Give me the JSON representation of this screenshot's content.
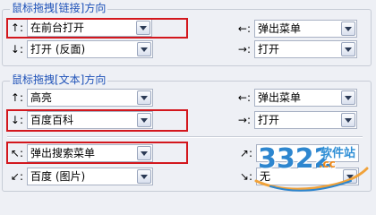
{
  "link_group": {
    "title": "鼠标拖拽[链接]方向",
    "up": {
      "glyph": "↑:",
      "value": "在前台打开"
    },
    "left": {
      "glyph": "←:",
      "value": "弹出菜单"
    },
    "down": {
      "glyph": "↓:",
      "value": "打开 (反面)"
    },
    "right": {
      "glyph": "→:",
      "value": "打开"
    }
  },
  "text_group": {
    "title": "鼠标拖拽[文本]方向",
    "up": {
      "glyph": "↑:",
      "value": "高亮"
    },
    "left": {
      "glyph": "←:",
      "value": "弹出菜单"
    },
    "down": {
      "glyph": "↓:",
      "value": "百度百科"
    },
    "right": {
      "glyph": "→:",
      "value": "打开"
    },
    "up_left": {
      "glyph": "↖:",
      "value": "弹出搜索菜单"
    },
    "down_left": {
      "glyph": "↙:",
      "value": "百度 (图片)"
    },
    "up_right": {
      "glyph": "↗:"
    },
    "down_right": {
      "glyph": "↘:",
      "value": "无"
    }
  },
  "watermark": {
    "number": "3322",
    "site_cn": "软件站",
    "url": ".cc"
  },
  "colors": {
    "group_title": "#1f52b8",
    "highlight": "#d3171d",
    "background": "#eef0f5"
  }
}
